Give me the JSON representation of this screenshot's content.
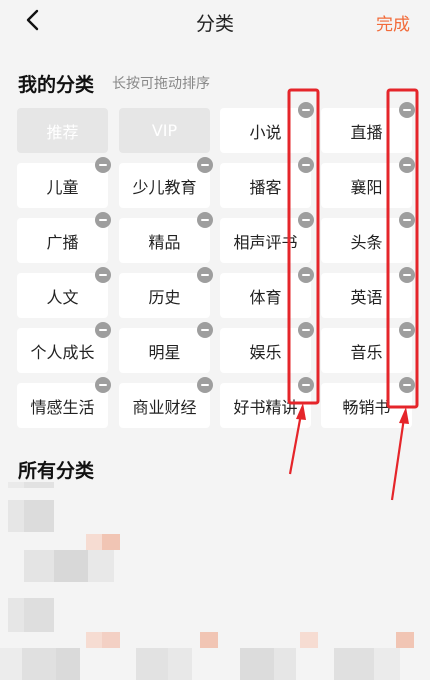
{
  "header": {
    "title": "分类",
    "done_label": "完成"
  },
  "my_categories": {
    "title": "我的分类",
    "hint": "长按可拖动排序",
    "items": [
      {
        "label": "推荐",
        "removable": false,
        "disabled": true
      },
      {
        "label": "VIP",
        "removable": false,
        "disabled": true
      },
      {
        "label": "小说",
        "removable": true,
        "disabled": false
      },
      {
        "label": "直播",
        "removable": true,
        "disabled": false
      },
      {
        "label": "儿童",
        "removable": true,
        "disabled": false
      },
      {
        "label": "少儿教育",
        "removable": true,
        "disabled": false
      },
      {
        "label": "播客",
        "removable": true,
        "disabled": false
      },
      {
        "label": "襄阳",
        "removable": true,
        "disabled": false
      },
      {
        "label": "广播",
        "removable": true,
        "disabled": false
      },
      {
        "label": "精品",
        "removable": true,
        "disabled": false
      },
      {
        "label": "相声评书",
        "removable": true,
        "disabled": false
      },
      {
        "label": "头条",
        "removable": true,
        "disabled": false
      },
      {
        "label": "人文",
        "removable": true,
        "disabled": false
      },
      {
        "label": "历史",
        "removable": true,
        "disabled": false
      },
      {
        "label": "体育",
        "removable": true,
        "disabled": false
      },
      {
        "label": "英语",
        "removable": true,
        "disabled": false
      },
      {
        "label": "个人成长",
        "removable": true,
        "disabled": false
      },
      {
        "label": "明星",
        "removable": true,
        "disabled": false
      },
      {
        "label": "娱乐",
        "removable": true,
        "disabled": false
      },
      {
        "label": "音乐",
        "removable": true,
        "disabled": false
      },
      {
        "label": "情感生活",
        "removable": true,
        "disabled": false
      },
      {
        "label": "商业财经",
        "removable": true,
        "disabled": false
      },
      {
        "label": "好书精讲",
        "removable": true,
        "disabled": false
      },
      {
        "label": "畅销书",
        "removable": true,
        "disabled": false
      }
    ]
  },
  "all_categories": {
    "title": "所有分类"
  },
  "colors": {
    "accent": "#f26b3a",
    "annotation": "#e5252a",
    "remove_badge": "#9e9e9e"
  },
  "icons": {
    "back": "chevron-left-icon",
    "remove": "minus-circle-icon"
  }
}
